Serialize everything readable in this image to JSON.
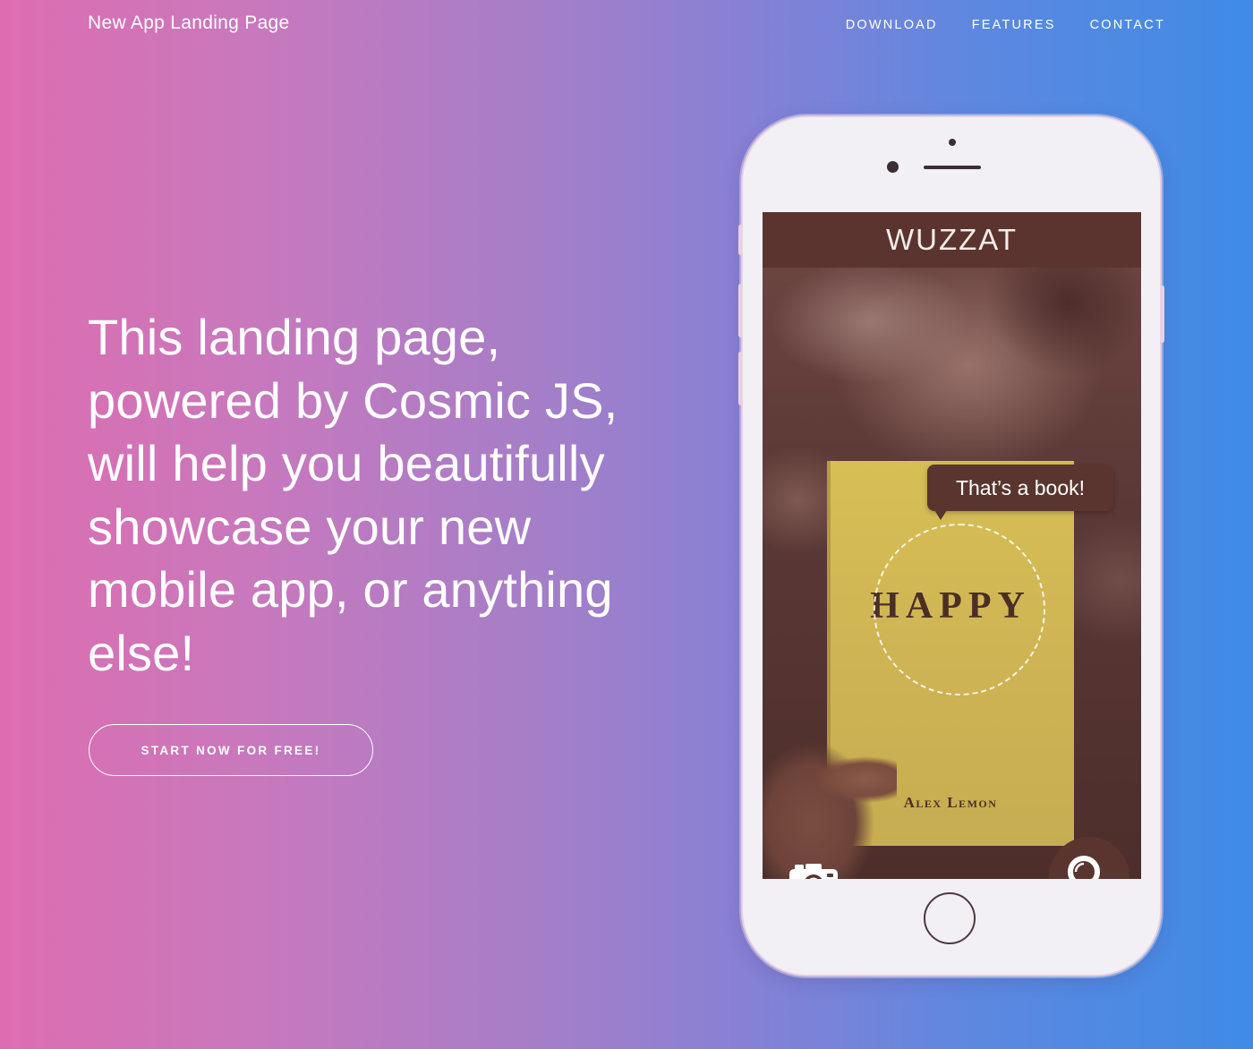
{
  "nav": {
    "brand": "New App Landing Page",
    "links": [
      "DOWNLOAD",
      "FEATURES",
      "CONTACT"
    ]
  },
  "hero": {
    "headline": "This landing page, powered by Cosmic JS, will help you beautifully showcase your new mobile app, or anything else!",
    "cta_label": "START NOW FOR FREE!"
  },
  "phone_app": {
    "app_name": "WUZZAT",
    "bubble_text": "That’s a book!",
    "book_title": "HAPPY",
    "book_author": "Alex Lemon",
    "icons": [
      "camera-icon",
      "search-icon"
    ]
  },
  "colors": {
    "gradient_start": "#dd6db0",
    "gradient_mid": "#a27fc9",
    "gradient_end": "#3f8be6",
    "app_brown": "#5b3430",
    "book_yellow": "#d3b955"
  }
}
